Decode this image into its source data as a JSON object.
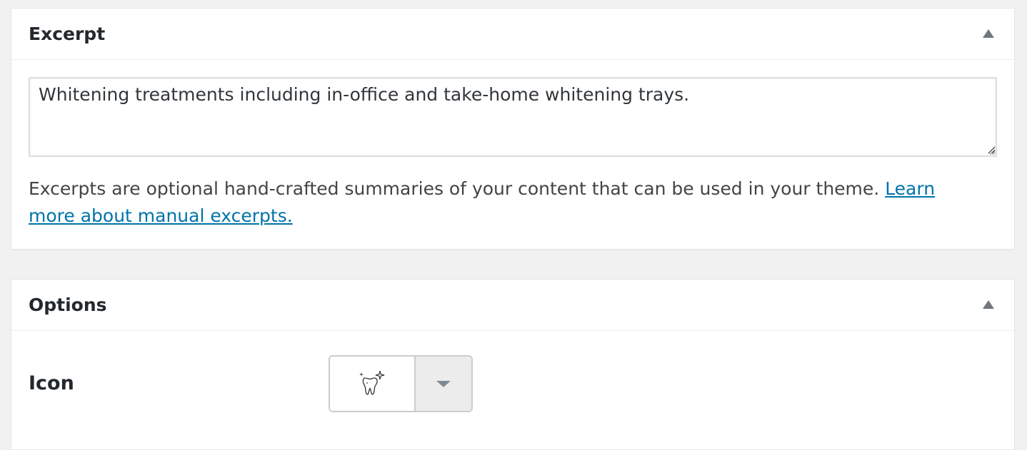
{
  "excerpt": {
    "title": "Excerpt",
    "text": "Whitening treatments including in-office and take-home whitening trays.",
    "description": "Excerpts are optional hand-crafted summaries of your content that can be used in your theme.",
    "link_text": "Learn more about manual excerpts."
  },
  "options": {
    "title": "Options",
    "icon_label": "Icon",
    "selected_icon": "tooth-sparkle-icon"
  },
  "colors": {
    "link": "#0073aa",
    "heading": "#23282d",
    "background": "#f1f1f1"
  }
}
